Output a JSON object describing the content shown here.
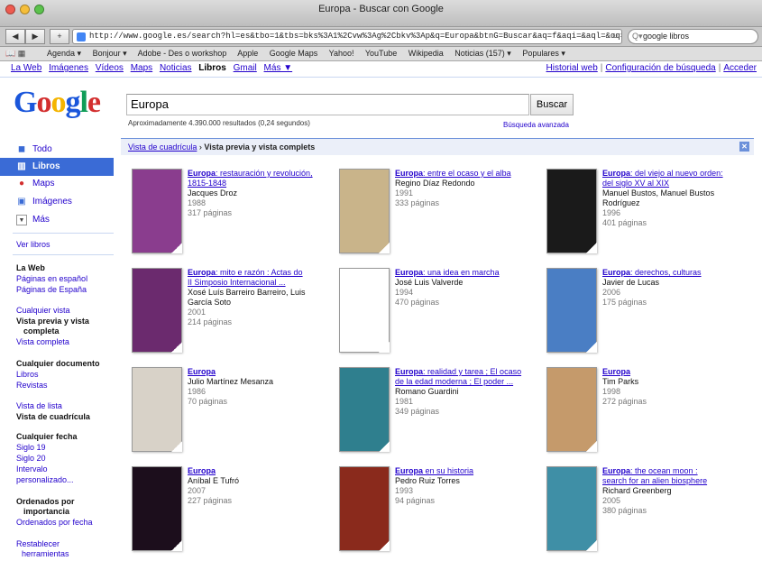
{
  "window": {
    "title": "Europa - Buscar con Google"
  },
  "browser": {
    "url": "http://www.google.es/search?hl=es&tbo=1&tbs=bks%3A1%2Cvw%3Ag%2Cbkv%3Ap&q=Europa&btnG=Buscar&aq=f&aqi=&aql=&oq=",
    "search_value": "google libros",
    "bookmarks": [
      "Agenda ▾",
      "Bonjour ▾",
      "Adobe - Des o workshop",
      "Apple",
      "Google Maps",
      "Yahoo!",
      "YouTube",
      "Wikipedia",
      "Noticias (157) ▾",
      "Populares ▾"
    ]
  },
  "gbar": {
    "links": [
      "La Web",
      "Imágenes",
      "Vídeos",
      "Maps",
      "Noticias"
    ],
    "active": "Libros",
    "links2": [
      "Gmail",
      "Más ▼"
    ],
    "right": [
      "Historial web",
      "Configuración de búsqueda",
      "Acceder"
    ]
  },
  "logo": [
    "G",
    "o",
    "o",
    "g",
    "l",
    "e"
  ],
  "search": {
    "query": "Europa",
    "button": "Buscar",
    "stats": "Aproximadamente 4.390.000 resultados (0,24 segundos)",
    "advanced": "Búsqueda avanzada"
  },
  "crumb": {
    "link": "Vista de cuadrícula",
    "current": "Vista previa y vista complets"
  },
  "leftnav": {
    "modes": [
      "Todo",
      "Libros",
      "Maps",
      "Imágenes",
      "Más"
    ],
    "ver_libros": "Ver libros",
    "h_web": "La Web",
    "web_links": [
      "Páginas en español",
      "Páginas de España"
    ],
    "view_link": "Cualquier vista",
    "view_sel1": "Vista previa y vista",
    "view_sel2": "completa",
    "view_full": "Vista completa",
    "h_doc": "Cualquier documento",
    "doc_links": [
      "Libros",
      "Revistas"
    ],
    "list_view": "Vista de lista",
    "grid_view": "Vista de cuadrícula",
    "h_date": "Cualquier fecha",
    "date_links": [
      "Siglo 19",
      "Siglo 20",
      "Intervalo",
      "personalizado..."
    ],
    "order1": "Ordenados por",
    "order2": "importancia",
    "order_date": "Ordenados por fecha",
    "reset1": "Restablecer",
    "reset2": "herramientas"
  },
  "results": [
    {
      "kw": "Europa",
      "rest": ": restauración y revolución,",
      "rest2": "1815-1848",
      "author": "Jacques Droz",
      "author2": "",
      "year": "1988",
      "pages": "317 páginas",
      "cover": "#8a3d8e"
    },
    {
      "kw": "Europa",
      "rest": ": entre el ocaso y el alba",
      "rest2": "",
      "author": "Regino Díaz Redondo",
      "author2": "",
      "year": "1991",
      "pages": "333 páginas",
      "cover": "#c9b48a"
    },
    {
      "kw": "Europa",
      "rest": ": del viejo al nuevo orden:",
      "rest2": "del siglo XV al XIX",
      "author": "Manuel Bustos, Manuel Bustos",
      "author2": "Rodríguez",
      "year": "1996",
      "pages": "401 páginas",
      "cover": "#1a1a1a"
    },
    {
      "kw": "Europa",
      "rest": ": mito e razón : Actas do",
      "rest2": "II Simposio Internacional ...",
      "author": "Xosé Luís Barreiro Barreiro, Luis",
      "author2": "García Soto",
      "year": "2001",
      "pages": "214 páginas",
      "cover": "#6b2a6e"
    },
    {
      "kw": "Europa",
      "rest": ": una idea en marcha",
      "rest2": "",
      "author": "José Luis Valverde",
      "author2": "",
      "year": "1994",
      "pages": "470 páginas",
      "cover": "#ffffff"
    },
    {
      "kw": "Europa",
      "rest": ": derechos, culturas",
      "rest2": "",
      "author": "Javier de Lucas",
      "author2": "",
      "year": "2006",
      "pages": "175 páginas",
      "cover": "#4a7ec4"
    },
    {
      "kw": "Europa",
      "rest": "",
      "rest2": "",
      "author": "Julio Martínez Mesanza",
      "author2": "",
      "year": "1986",
      "pages": "70 páginas",
      "cover": "#d8d2c8"
    },
    {
      "kw": "Europa",
      "rest": ": realidad y tarea ; El ocaso",
      "rest2": "de la edad moderna ; El poder ...",
      "author": "Romano Guardini",
      "author2": "",
      "year": "1981",
      "pages": "349 páginas",
      "cover": "#2f7f8e"
    },
    {
      "kw": "Europa",
      "rest": "",
      "rest2": "",
      "author": "Tim Parks",
      "author2": "",
      "year": "1998",
      "pages": "272 páginas",
      "cover": "#c59a6b"
    },
    {
      "kw": "Europa",
      "rest": "",
      "rest2": "",
      "author": "Aníbal E Tufró",
      "author2": "",
      "year": "2007",
      "pages": "227 páginas",
      "cover": "#1c0e1c"
    },
    {
      "kw": "Europa",
      "rest": " en su historia",
      "rest2": "",
      "author": "Pedro Ruiz Torres",
      "author2": "",
      "year": "1993",
      "pages": "94 páginas",
      "cover": "#8a2a1c"
    },
    {
      "kw": "Europa",
      "rest": ": the ocean moon :",
      "rest2": "search for an alien biosphere",
      "author": "Richard Greenberg",
      "author2": "",
      "year": "2005",
      "pages": "380 páginas",
      "cover": "#3f8fa6"
    }
  ]
}
